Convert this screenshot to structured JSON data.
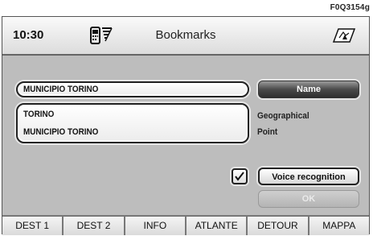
{
  "figure_code": "F0Q3154g",
  "header": {
    "time": "10:30",
    "title": "Bookmarks",
    "phone_icon": "phone-signal-icon",
    "nav_icon": "navigation-map-icon"
  },
  "form": {
    "name_value": "MUNICIPIO TORINO",
    "geo_line1": "TORINO",
    "geo_line2": "MUNICIPIO TORINO",
    "name_button": "Name",
    "geo_label_line1": "Geographical",
    "geo_label_line2": "Point",
    "voice_checked": true,
    "voice_button": "Voice recognition",
    "ok_button": "OK"
  },
  "tabs": [
    "DEST 1",
    "DEST 2",
    "INFO",
    "ATLANTE",
    "DETOUR",
    "MAPPA"
  ]
}
